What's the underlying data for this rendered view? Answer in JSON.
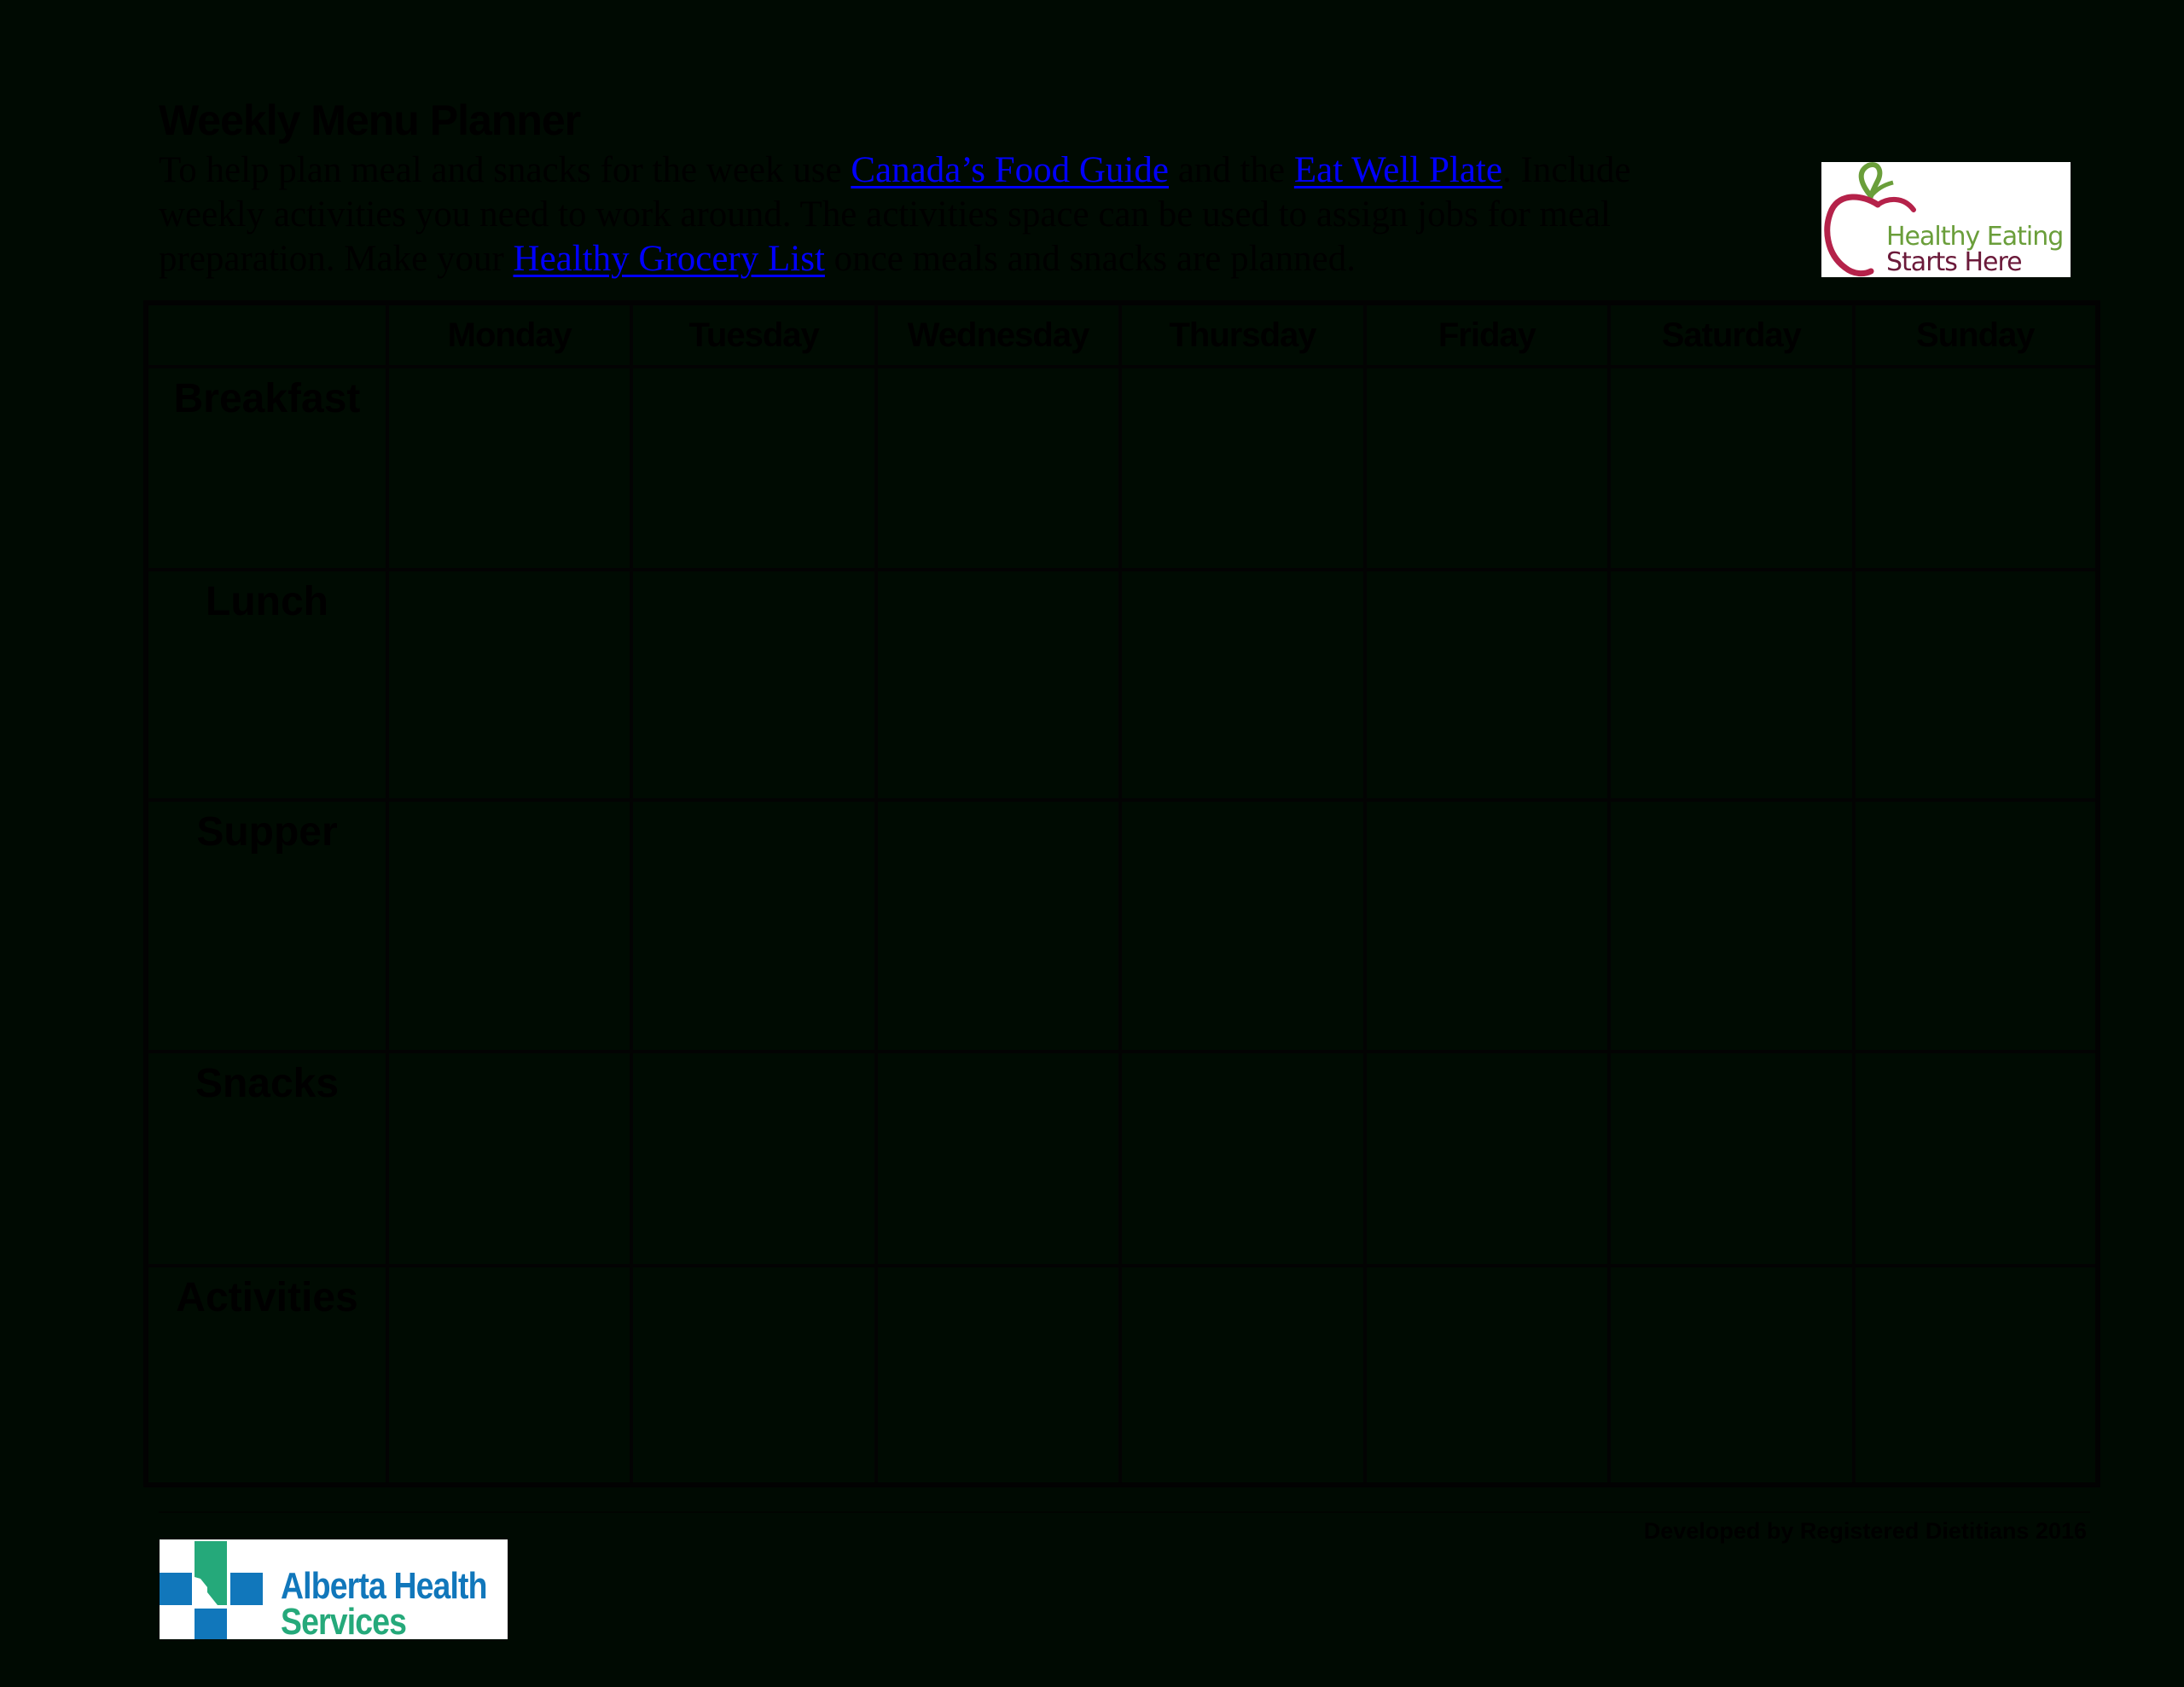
{
  "document": {
    "title": "Weekly Menu Planner",
    "intro": {
      "line1_prefix": "To help plan meal and snacks for the week use ",
      "link_food_guide": "Canada’s Food Guide",
      "line1_middle": " and the ",
      "link_eat_well": "Eat Well Plate",
      "line1_suffix": ". Include",
      "line2": "weekly activities you need to work around. The activities space can be used to assign jobs for meal",
      "line3_prefix": "preparation. Make your ",
      "link_grocery": "Healthy Grocery List",
      "line3_suffix": " once meals and snacks are planned."
    },
    "link_color": "#0000ff"
  },
  "logo_top": {
    "icon": "apple-icon",
    "line1": "Healthy Eating",
    "line2": "Starts Here",
    "colors": {
      "apple": "#b5224a",
      "leaf": "#6a9e3a",
      "line1": "#6a9e3a",
      "line2": "#6b1a3a"
    }
  },
  "planner": {
    "corner": "",
    "days": [
      "Monday",
      "Tuesday",
      "Wednesday",
      "Thursday",
      "Friday",
      "Saturday",
      "Sunday"
    ],
    "rows": [
      {
        "label": "Breakfast",
        "cells": [
          "",
          "",
          "",
          "",
          "",
          "",
          ""
        ]
      },
      {
        "label": "Lunch",
        "cells": [
          "",
          "",
          "",
          "",
          "",
          "",
          ""
        ]
      },
      {
        "label": "Supper",
        "cells": [
          "",
          "",
          "",
          "",
          "",
          "",
          ""
        ]
      },
      {
        "label": "Snacks",
        "cells": [
          "",
          "",
          "",
          "",
          "",
          "",
          ""
        ]
      },
      {
        "label": "Activities",
        "cells": [
          "",
          "",
          "",
          "",
          "",
          "",
          ""
        ]
      }
    ]
  },
  "footer": {
    "credit": "Developed by Registered Dietitians 2016",
    "logo": {
      "icon": "cross-icon",
      "line1": "Alberta Health",
      "line2": "Services",
      "colors": {
        "blue": "#1177bb",
        "green": "#25a97a"
      }
    }
  }
}
